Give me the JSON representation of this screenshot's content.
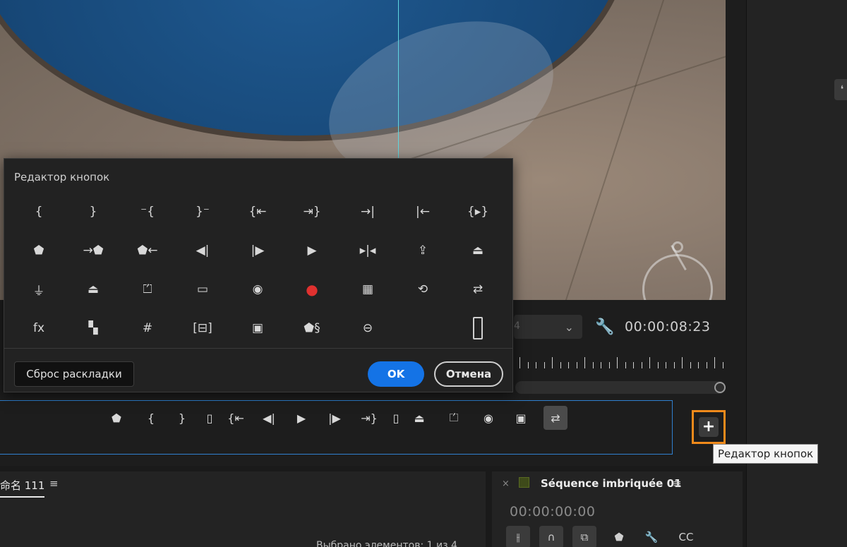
{
  "dialog": {
    "title": "Редактор кнопок",
    "reset_label": "Сброс раскладки",
    "ok_label": "OK",
    "cancel_label": "Отмена",
    "buttons": [
      {
        "name": "mark-in-icon",
        "glyph": "{"
      },
      {
        "name": "mark-out-icon",
        "glyph": "}"
      },
      {
        "name": "mark-clip-in-icon",
        "glyph": "⁻{"
      },
      {
        "name": "mark-clip-out-icon",
        "glyph": "}⁻"
      },
      {
        "name": "go-to-in-icon",
        "glyph": "{⇤"
      },
      {
        "name": "go-to-out-icon",
        "glyph": "⇥}"
      },
      {
        "name": "go-to-next-edit-icon",
        "glyph": "→|"
      },
      {
        "name": "go-to-previous-edit-icon",
        "glyph": "|←"
      },
      {
        "name": "play-in-to-out-icon",
        "glyph": "{▸}"
      },
      {
        "name": "add-marker-icon",
        "glyph": "⬟"
      },
      {
        "name": "go-to-next-marker-icon",
        "glyph": "→⬟"
      },
      {
        "name": "go-to-previous-marker-icon",
        "glyph": "⬟←"
      },
      {
        "name": "step-back-icon",
        "glyph": "◀|"
      },
      {
        "name": "step-forward-icon",
        "glyph": "|▶"
      },
      {
        "name": "play-icon",
        "glyph": "▶"
      },
      {
        "name": "play-around-icon",
        "glyph": "▸|◂"
      },
      {
        "name": "export-icon",
        "glyph": "⇪"
      },
      {
        "name": "lift-icon",
        "glyph": "⏏"
      },
      {
        "name": "insert-icon",
        "glyph": "⏚"
      },
      {
        "name": "overwrite-icon",
        "glyph": "⏏"
      },
      {
        "name": "extract-icon",
        "glyph": "⏍"
      },
      {
        "name": "safe-margins-icon",
        "glyph": "▭"
      },
      {
        "name": "export-frame-icon",
        "glyph": "◉"
      },
      {
        "name": "record-icon",
        "glyph": "●"
      },
      {
        "name": "multicam-icon",
        "glyph": "▦"
      },
      {
        "name": "loop-icon",
        "glyph": "⟲"
      },
      {
        "name": "toggle-proxies-icon",
        "glyph": "⇄"
      },
      {
        "name": "fx-icon",
        "glyph": "fx"
      },
      {
        "name": "film-strip-icon",
        "glyph": "▚"
      },
      {
        "name": "grid-icon",
        "glyph": "#"
      },
      {
        "name": "vr-video-icon",
        "glyph": "[⊟]"
      },
      {
        "name": "comparison-view-icon",
        "glyph": "▣"
      },
      {
        "name": "marker-link-icon",
        "glyph": "⬟§"
      },
      {
        "name": "vr-headset-icon",
        "glyph": "⊖"
      },
      {
        "name": "empty-slot",
        "glyph": ""
      },
      {
        "name": "spacer-icon",
        "glyph": ""
      }
    ]
  },
  "monitor": {
    "timecode": "00:00:08:23",
    "fit_value": "4"
  },
  "transport": {
    "buttons": [
      {
        "name": "add-marker-icon",
        "glyph": "⬟",
        "active": false
      },
      {
        "name": "mark-in-icon",
        "glyph": "{",
        "active": false
      },
      {
        "name": "mark-out-icon",
        "glyph": "}",
        "active": false
      },
      {
        "name": "spacer-icon",
        "glyph": "▯",
        "active": false
      },
      {
        "name": "go-to-in-icon",
        "glyph": "{⇤",
        "active": false
      },
      {
        "name": "step-back-icon",
        "glyph": "◀|",
        "active": false
      },
      {
        "name": "play-icon",
        "glyph": "▶",
        "active": false
      },
      {
        "name": "step-forward-icon",
        "glyph": "|▶",
        "active": false
      },
      {
        "name": "go-to-out-icon",
        "glyph": "⇥}",
        "active": false
      },
      {
        "name": "spacer-icon",
        "glyph": "▯",
        "active": false
      },
      {
        "name": "lift-icon",
        "glyph": "⏏",
        "active": false
      },
      {
        "name": "extract-icon",
        "glyph": "⏍",
        "active": false
      },
      {
        "name": "export-frame-icon",
        "glyph": "◉",
        "active": false
      },
      {
        "name": "comparison-view-icon",
        "glyph": "▣",
        "active": false
      },
      {
        "name": "toggle-proxies-icon",
        "glyph": "⇄",
        "active": true
      }
    ],
    "add_button_glyph": "+",
    "tooltip": "Редактор кнопок"
  },
  "project_panel": {
    "tab_label": "命名 111",
    "menu_glyph": "≡",
    "status": "Выбрано элементов: 1 из 4"
  },
  "sequence_panel": {
    "close_glyph": "×",
    "title": "Séquence imbriquée 01",
    "menu_glyph": "≡",
    "timecode": "00:00:00:00",
    "tools": [
      {
        "name": "snap-icon",
        "glyph": "⫲",
        "boxed": true
      },
      {
        "name": "magnet-icon",
        "glyph": "∩",
        "boxed": true
      },
      {
        "name": "linked-selection-icon",
        "glyph": "⧉",
        "boxed": true
      },
      {
        "name": "add-marker-icon",
        "glyph": "⬟",
        "boxed": false
      },
      {
        "name": "wrench-icon",
        "glyph": "🔧",
        "boxed": false
      },
      {
        "name": "captions-icon",
        "glyph": "CC",
        "boxed": false
      }
    ]
  }
}
